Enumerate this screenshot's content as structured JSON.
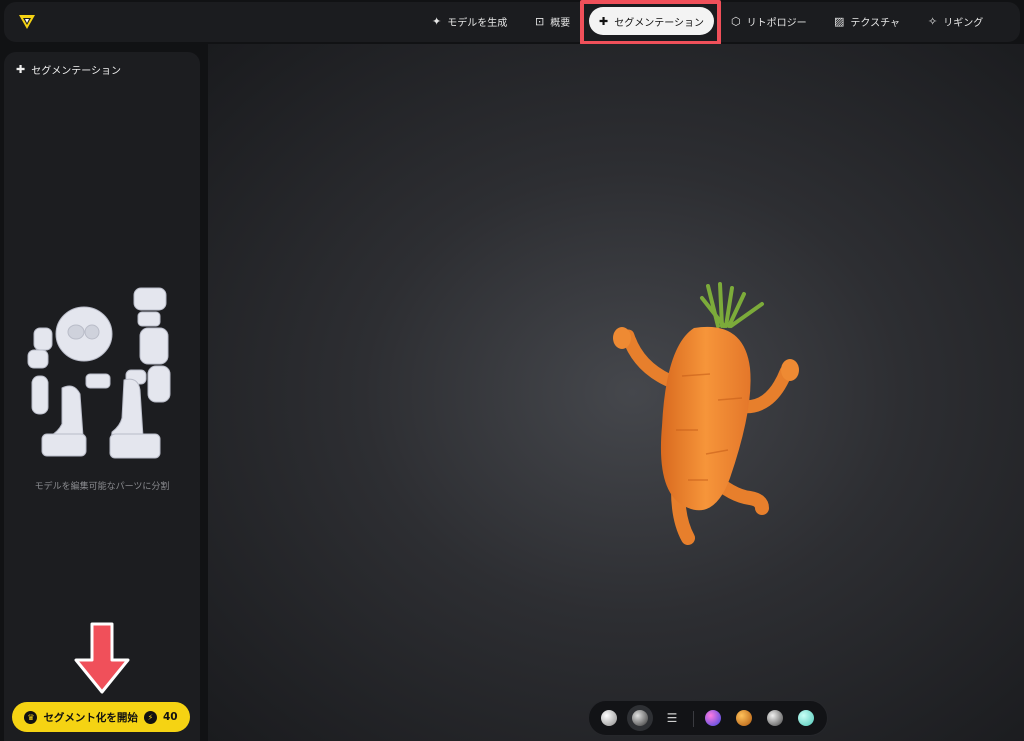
{
  "nav": {
    "generate": {
      "icon": "sparkle-icon",
      "label": "モデルを生成"
    },
    "overview": {
      "icon": "focus-frame-icon",
      "label": "概要"
    },
    "segmentation": {
      "icon": "puzzle-icon",
      "label": "セグメンテーション"
    },
    "retopology": {
      "icon": "hexagon-mesh-icon",
      "label": "リトポロジー"
    },
    "texture": {
      "icon": "diagonal-stripes-icon",
      "label": "テクスチャ"
    },
    "rigging": {
      "icon": "figure-icon",
      "label": "リギング"
    }
  },
  "sidebar": {
    "title": "セグメンテーション",
    "caption": "モデルを編集可能なパーツに分割",
    "start_button": {
      "label": "セグメント化を開始",
      "cost": "40"
    }
  },
  "colors": {
    "accent_yellow": "#f5d313",
    "highlight_red": "#f0505a",
    "background": "#111214"
  },
  "toolbar": {
    "items": [
      "white-sphere",
      "dark-sphere-selected",
      "sliders-icon",
      "purple-sphere",
      "orange-sphere",
      "gray-sphere",
      "teal-sphere"
    ]
  }
}
